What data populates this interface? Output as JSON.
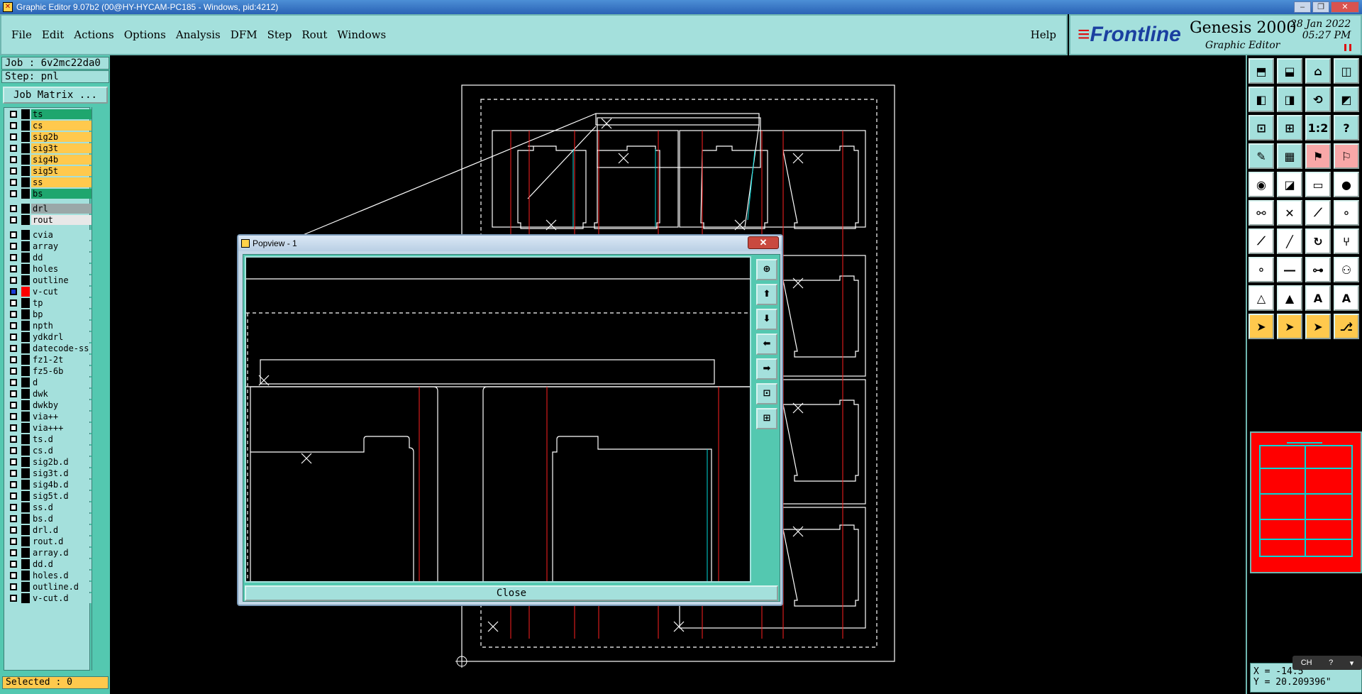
{
  "window": {
    "title": "Graphic Editor 9.07b2 (00@HY-HYCAM-PC185 - Windows, pid:4212)"
  },
  "menu": {
    "items": [
      {
        "label": "File",
        "u": "F"
      },
      {
        "label": "Edit",
        "u": "E"
      },
      {
        "label": "Actions",
        "u": "A"
      },
      {
        "label": "Options",
        "u": "O"
      },
      {
        "label": "Analysis",
        "u": "A"
      },
      {
        "label": "DFM",
        "u": "D"
      },
      {
        "label": "Step",
        "u": "S"
      },
      {
        "label": "Rout",
        "u": "R"
      },
      {
        "label": "Windows",
        "u": "W"
      }
    ],
    "help": "Help"
  },
  "brand": {
    "logo": "Frontline",
    "product": "Genesis 2000",
    "subtitle": "Graphic Editor",
    "date": "28 Jan 2022",
    "time": "05:27 PM"
  },
  "job": {
    "job_label": "Job : 6v2mc22da0",
    "step_label": "Step: pnl",
    "matrix_button": "Job Matrix ..."
  },
  "colors": {
    "panel": "#a4e0dc",
    "panel_dark": "#54c8b0",
    "orange": "#ffc94d",
    "green": "#1ea66e",
    "gray": "#9aa8a8",
    "red": "#ff0000",
    "profile": "#ffffff",
    "cyan": "#00d8d8",
    "redline": "#ff2020"
  },
  "layers": [
    {
      "name": "ts",
      "bg": "#1ea66e"
    },
    {
      "name": "cs",
      "bg": "#ffc94d"
    },
    {
      "name": "sig2b",
      "bg": "#ffc94d"
    },
    {
      "name": "sig3t",
      "bg": "#ffc94d"
    },
    {
      "name": "sig4b",
      "bg": "#ffc94d"
    },
    {
      "name": "sig5t",
      "bg": "#ffc94d"
    },
    {
      "name": "ss",
      "bg": "#ffc94d"
    },
    {
      "name": "bs",
      "bg": "#1ea66e",
      "gap_after": true
    },
    {
      "name": "drl",
      "bg": "#9aa8a8"
    },
    {
      "name": "rout",
      "bg": "#e8e8e8",
      "gap_after": true
    },
    {
      "name": "cvia",
      "bg": "#a4e0dc"
    },
    {
      "name": "array",
      "bg": "#a4e0dc"
    },
    {
      "name": "dd",
      "bg": "#a4e0dc"
    },
    {
      "name": "holes",
      "bg": "#a4e0dc"
    },
    {
      "name": "outline",
      "bg": "#a4e0dc"
    },
    {
      "name": "v-cut",
      "bg": "#a4e0dc",
      "active": true
    },
    {
      "name": "tp",
      "bg": "#a4e0dc"
    },
    {
      "name": "bp",
      "bg": "#a4e0dc"
    },
    {
      "name": "npth",
      "bg": "#a4e0dc"
    },
    {
      "name": "ydkdrl",
      "bg": "#a4e0dc"
    },
    {
      "name": "datecode-ss",
      "bg": "#a4e0dc"
    },
    {
      "name": "fz1-2t",
      "bg": "#a4e0dc"
    },
    {
      "name": "fz5-6b",
      "bg": "#a4e0dc"
    },
    {
      "name": "d",
      "bg": "#a4e0dc"
    },
    {
      "name": "dwk",
      "bg": "#a4e0dc"
    },
    {
      "name": "dwkby",
      "bg": "#a4e0dc"
    },
    {
      "name": "via++",
      "bg": "#a4e0dc"
    },
    {
      "name": "via+++",
      "bg": "#a4e0dc"
    },
    {
      "name": "ts.d",
      "bg": "#a4e0dc"
    },
    {
      "name": "cs.d",
      "bg": "#a4e0dc"
    },
    {
      "name": "sig2b.d",
      "bg": "#a4e0dc"
    },
    {
      "name": "sig3t.d",
      "bg": "#a4e0dc"
    },
    {
      "name": "sig4b.d",
      "bg": "#a4e0dc"
    },
    {
      "name": "sig5t.d",
      "bg": "#a4e0dc"
    },
    {
      "name": "ss.d",
      "bg": "#a4e0dc"
    },
    {
      "name": "bs.d",
      "bg": "#a4e0dc"
    },
    {
      "name": "drl.d",
      "bg": "#a4e0dc"
    },
    {
      "name": "rout.d",
      "bg": "#a4e0dc"
    },
    {
      "name": "array.d",
      "bg": "#a4e0dc"
    },
    {
      "name": "dd.d",
      "bg": "#a4e0dc"
    },
    {
      "name": "holes.d",
      "bg": "#a4e0dc"
    },
    {
      "name": "outline.d",
      "bg": "#a4e0dc"
    },
    {
      "name": "v-cut.d",
      "bg": "#a4e0dc"
    }
  ],
  "status": {
    "selected": "Selected : 0"
  },
  "coords": {
    "x": "X = -14.5",
    "y": "Y = 20.209396\""
  },
  "ime": {
    "lang": "CH"
  },
  "popview": {
    "title": "Popview - 1",
    "close_button": "Close",
    "close_x": "✕"
  },
  "toolbar_icons": [
    "zoom-home-icon",
    "step-in-icon",
    "home-icon",
    "panel-split-icon",
    "pan-left-icon",
    "pan-right-icon",
    "undo-redo-icon",
    "split-view-icon",
    "fit-icon",
    "fit-center-icon",
    "one-to-two-icon",
    "help-icon",
    "measure-icon",
    "grid-icon",
    "layer-colors-icon",
    "layer-swap-icon",
    "select-feature-icon",
    "snap-icon",
    "ruler-icon",
    "pad-icon",
    "connect-icon",
    "cross-icon",
    "line-draw-icon",
    "net-icon",
    "red-line-icon",
    "slash-icon",
    "arc-icon",
    "fork-icon",
    "pad-add-icon",
    "move-line-icon",
    "stretch-icon",
    "circles-icon",
    "triangle-icon",
    "triangle-fill-icon",
    "text-a-icon",
    "text-b-icon",
    "pointer-icon",
    "pointer-select-icon",
    "pointer-edit-icon",
    "route-icon"
  ],
  "popview_tools": [
    "pv-zoom-icon",
    "pv-up-icon",
    "pv-down-icon",
    "pv-left-icon",
    "pv-right-icon",
    "pv-fit-icon",
    "pv-center-icon"
  ]
}
